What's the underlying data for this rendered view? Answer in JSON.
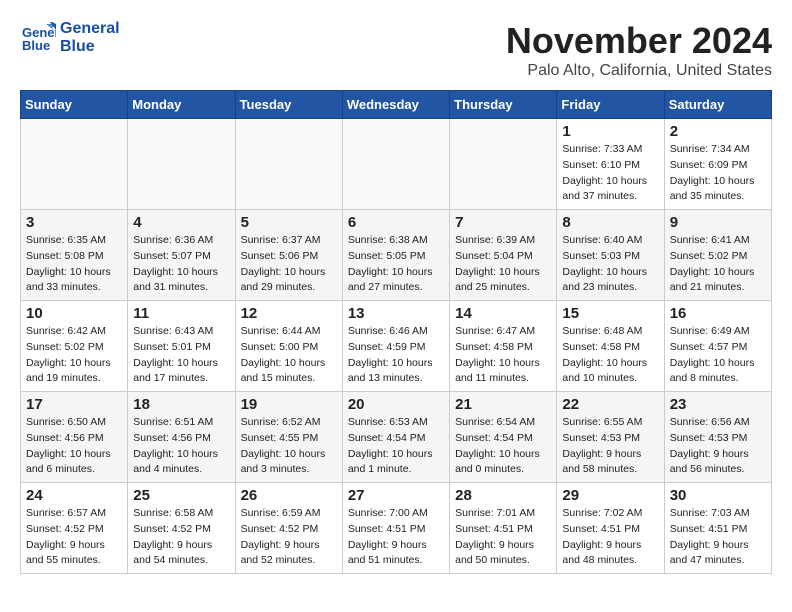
{
  "header": {
    "logo_line1": "General",
    "logo_line2": "Blue",
    "month": "November 2024",
    "location": "Palo Alto, California, United States"
  },
  "weekdays": [
    "Sunday",
    "Monday",
    "Tuesday",
    "Wednesday",
    "Thursday",
    "Friday",
    "Saturday"
  ],
  "weeks": [
    [
      {
        "day": "",
        "info": ""
      },
      {
        "day": "",
        "info": ""
      },
      {
        "day": "",
        "info": ""
      },
      {
        "day": "",
        "info": ""
      },
      {
        "day": "",
        "info": ""
      },
      {
        "day": "1",
        "info": "Sunrise: 7:33 AM\nSunset: 6:10 PM\nDaylight: 10 hours\nand 37 minutes."
      },
      {
        "day": "2",
        "info": "Sunrise: 7:34 AM\nSunset: 6:09 PM\nDaylight: 10 hours\nand 35 minutes."
      }
    ],
    [
      {
        "day": "3",
        "info": "Sunrise: 6:35 AM\nSunset: 5:08 PM\nDaylight: 10 hours\nand 33 minutes."
      },
      {
        "day": "4",
        "info": "Sunrise: 6:36 AM\nSunset: 5:07 PM\nDaylight: 10 hours\nand 31 minutes."
      },
      {
        "day": "5",
        "info": "Sunrise: 6:37 AM\nSunset: 5:06 PM\nDaylight: 10 hours\nand 29 minutes."
      },
      {
        "day": "6",
        "info": "Sunrise: 6:38 AM\nSunset: 5:05 PM\nDaylight: 10 hours\nand 27 minutes."
      },
      {
        "day": "7",
        "info": "Sunrise: 6:39 AM\nSunset: 5:04 PM\nDaylight: 10 hours\nand 25 minutes."
      },
      {
        "day": "8",
        "info": "Sunrise: 6:40 AM\nSunset: 5:03 PM\nDaylight: 10 hours\nand 23 minutes."
      },
      {
        "day": "9",
        "info": "Sunrise: 6:41 AM\nSunset: 5:02 PM\nDaylight: 10 hours\nand 21 minutes."
      }
    ],
    [
      {
        "day": "10",
        "info": "Sunrise: 6:42 AM\nSunset: 5:02 PM\nDaylight: 10 hours\nand 19 minutes."
      },
      {
        "day": "11",
        "info": "Sunrise: 6:43 AM\nSunset: 5:01 PM\nDaylight: 10 hours\nand 17 minutes."
      },
      {
        "day": "12",
        "info": "Sunrise: 6:44 AM\nSunset: 5:00 PM\nDaylight: 10 hours\nand 15 minutes."
      },
      {
        "day": "13",
        "info": "Sunrise: 6:46 AM\nSunset: 4:59 PM\nDaylight: 10 hours\nand 13 minutes."
      },
      {
        "day": "14",
        "info": "Sunrise: 6:47 AM\nSunset: 4:58 PM\nDaylight: 10 hours\nand 11 minutes."
      },
      {
        "day": "15",
        "info": "Sunrise: 6:48 AM\nSunset: 4:58 PM\nDaylight: 10 hours\nand 10 minutes."
      },
      {
        "day": "16",
        "info": "Sunrise: 6:49 AM\nSunset: 4:57 PM\nDaylight: 10 hours\nand 8 minutes."
      }
    ],
    [
      {
        "day": "17",
        "info": "Sunrise: 6:50 AM\nSunset: 4:56 PM\nDaylight: 10 hours\nand 6 minutes."
      },
      {
        "day": "18",
        "info": "Sunrise: 6:51 AM\nSunset: 4:56 PM\nDaylight: 10 hours\nand 4 minutes."
      },
      {
        "day": "19",
        "info": "Sunrise: 6:52 AM\nSunset: 4:55 PM\nDaylight: 10 hours\nand 3 minutes."
      },
      {
        "day": "20",
        "info": "Sunrise: 6:53 AM\nSunset: 4:54 PM\nDaylight: 10 hours\nand 1 minute."
      },
      {
        "day": "21",
        "info": "Sunrise: 6:54 AM\nSunset: 4:54 PM\nDaylight: 10 hours\nand 0 minutes."
      },
      {
        "day": "22",
        "info": "Sunrise: 6:55 AM\nSunset: 4:53 PM\nDaylight: 9 hours\nand 58 minutes."
      },
      {
        "day": "23",
        "info": "Sunrise: 6:56 AM\nSunset: 4:53 PM\nDaylight: 9 hours\nand 56 minutes."
      }
    ],
    [
      {
        "day": "24",
        "info": "Sunrise: 6:57 AM\nSunset: 4:52 PM\nDaylight: 9 hours\nand 55 minutes."
      },
      {
        "day": "25",
        "info": "Sunrise: 6:58 AM\nSunset: 4:52 PM\nDaylight: 9 hours\nand 54 minutes."
      },
      {
        "day": "26",
        "info": "Sunrise: 6:59 AM\nSunset: 4:52 PM\nDaylight: 9 hours\nand 52 minutes."
      },
      {
        "day": "27",
        "info": "Sunrise: 7:00 AM\nSunset: 4:51 PM\nDaylight: 9 hours\nand 51 minutes."
      },
      {
        "day": "28",
        "info": "Sunrise: 7:01 AM\nSunset: 4:51 PM\nDaylight: 9 hours\nand 50 minutes."
      },
      {
        "day": "29",
        "info": "Sunrise: 7:02 AM\nSunset: 4:51 PM\nDaylight: 9 hours\nand 48 minutes."
      },
      {
        "day": "30",
        "info": "Sunrise: 7:03 AM\nSunset: 4:51 PM\nDaylight: 9 hours\nand 47 minutes."
      }
    ]
  ]
}
